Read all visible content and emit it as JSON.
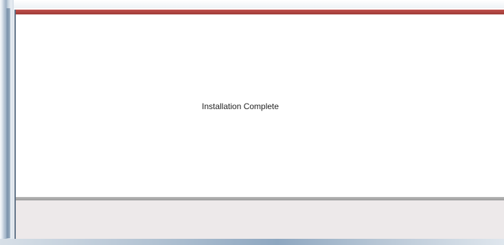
{
  "dialog": {
    "status_text": "Installation Complete"
  },
  "colors": {
    "title_accent": "#b0443f",
    "button_panel": "#ede9ea",
    "divider": "#a8a8a8",
    "frame": "#9fb2c6"
  }
}
